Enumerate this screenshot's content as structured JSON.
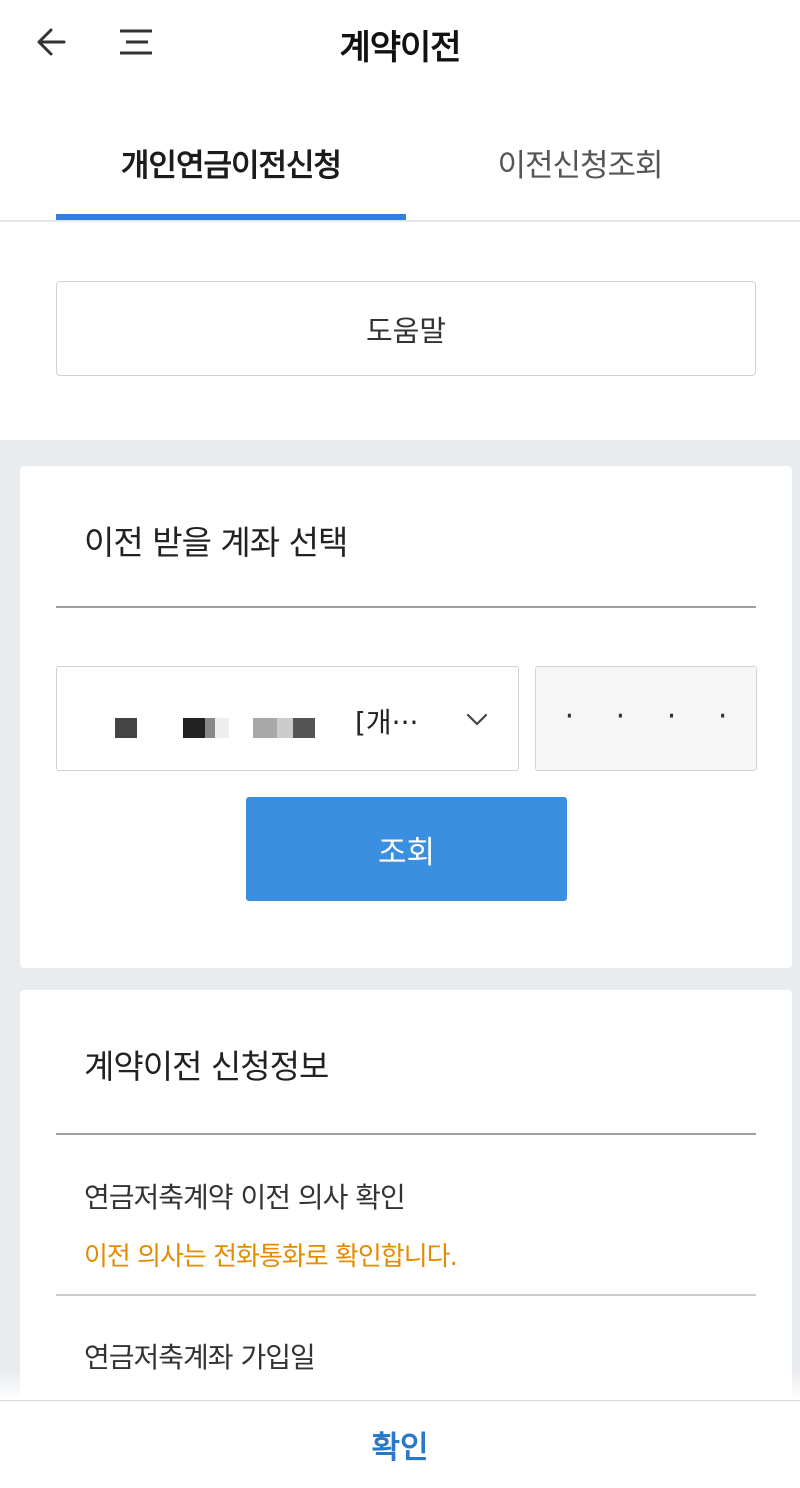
{
  "header": {
    "title": "계약이전",
    "back_icon": "arrow-left-icon",
    "menu_icon": "menu-icon"
  },
  "tabs": [
    {
      "label": "개인연금이전신청",
      "active": true
    },
    {
      "label": "이전신청조회",
      "active": false
    }
  ],
  "help": {
    "label": "도움말"
  },
  "account_section": {
    "title": "이전 받을 계좌 선택",
    "select_value": "[개···",
    "password_placeholder": "· · · ·",
    "query_label": "조회"
  },
  "info_section": {
    "title": "계약이전 신청정보",
    "rows": [
      {
        "label": "연금저축계약 이전 의사 확인",
        "value": "이전 의사는 전화통화로 확인합니다."
      },
      {
        "label": "연금저축계좌 가입일",
        "value": ""
      }
    ]
  },
  "footer": {
    "confirm_label": "확인"
  },
  "colors": {
    "accent": "#2f7fdc",
    "button": "#3b8fe0",
    "warning": "#e68a00",
    "confirm": "#2a78c8"
  }
}
